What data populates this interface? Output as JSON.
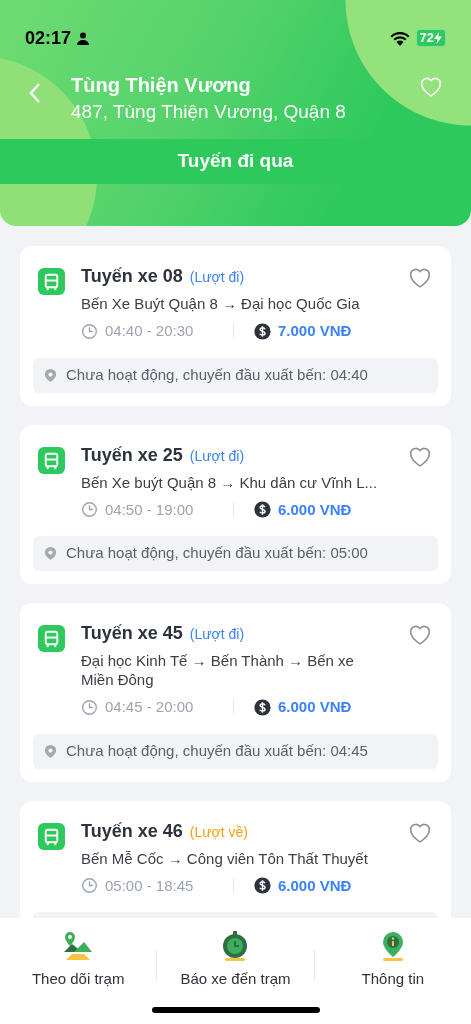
{
  "status_bar": {
    "time": "02:17",
    "battery": "72"
  },
  "header": {
    "title": "Tùng Thiện Vương",
    "address": "487, Tùng Thiện Vương, Quận 8",
    "section": "Tuyến đi qua"
  },
  "routes": [
    {
      "name": "Tuyến xe 08",
      "direction": "(Lượt đi)",
      "kind": "outbound",
      "path": "Bến Xe Buýt Quận 8 → Đại học Quốc Gia",
      "hours": "04:40 - 20:30",
      "fare": "7.000 VNĐ",
      "notice": "Chưa hoạt động, chuyến đầu xuất bến: 04:40"
    },
    {
      "name": "Tuyến xe 25",
      "direction": "(Lượt đi)",
      "kind": "outbound",
      "path": "Bến Xe buýt Quận 8 → Khu dân cư Vĩnh L...",
      "hours": "04:50 - 19:00",
      "fare": "6.000 VNĐ",
      "notice": "Chưa hoạt động, chuyến đầu xuất bến: 05:00"
    },
    {
      "name": "Tuyến xe 45",
      "direction": "(Lượt đi)",
      "kind": "outbound",
      "path": "Đại học Kinh Tế → Bến Thành → Bến xe Miền Đông",
      "hours": "04:45 - 20:00",
      "fare": "6.000 VNĐ",
      "notice": "Chưa hoạt động, chuyến đầu xuất bến: 04:45"
    },
    {
      "name": "Tuyến xe 46",
      "direction": "(Lượt về)",
      "kind": "return",
      "path": "Bến Mễ Cốc → Công viên Tôn Thất Thuyết",
      "hours": "05:00 - 18:45",
      "fare": "6.000 VNĐ"
    }
  ],
  "tabs": [
    {
      "label": "Theo dõi trạm",
      "kind": "map"
    },
    {
      "label": "Báo xe đến trạm",
      "kind": "alarm"
    },
    {
      "label": "Thông tin",
      "kind": "info"
    }
  ]
}
